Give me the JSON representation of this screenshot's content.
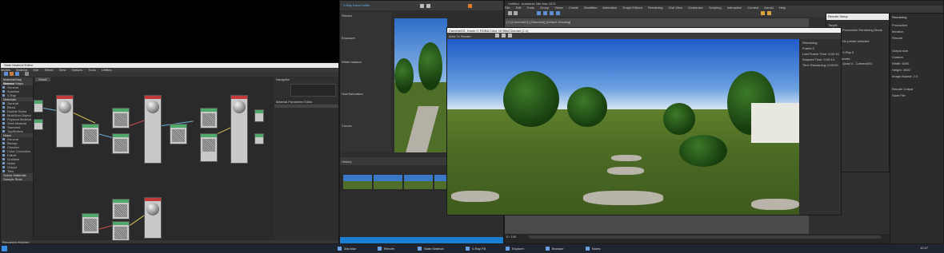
{
  "slate": {
    "title": "Slate Material Editor",
    "menu": [
      "Modes",
      "Material",
      "Edit",
      "Select",
      "View",
      "Options",
      "Tools",
      "Utilities"
    ],
    "view_tab": "View1",
    "browser_head": "Material/Map Browser",
    "browser_items": [
      "Material Maps",
      "General",
      "Scanline",
      "V-Ray",
      "Materials",
      "General",
      "Blend",
      "Double Sided",
      "Multi/Sub-Object",
      "Physical Material",
      "Shell Material",
      "Standard",
      "Top/Bottom",
      "Maps",
      "General",
      "Bitmap",
      "Checker",
      "Color Correction",
      "Falloff",
      "Gradient",
      "Noise",
      "Output",
      "Tiles",
      "Scene Materials",
      "Sample Slots"
    ],
    "navigator": "Navigator",
    "param_editor": "Material Parameter Editor",
    "status": "Rendering finished"
  },
  "vfb": {
    "title": "V-Ray frame buffer",
    "tab": "Stream",
    "label_a": "Exposure",
    "label_b": "White balance",
    "label_c": "Hue/Saturation",
    "label_d": "Curves",
    "history": "History"
  },
  "max": {
    "title": "Untitled - Autodesk 3ds Max 2021",
    "menu": [
      "File",
      "Edit",
      "Tools",
      "Group",
      "Views",
      "Create",
      "Modifiers",
      "Animation",
      "Graph Editors",
      "Rendering",
      "Civil View",
      "Customize",
      "Scripting",
      "Interactive",
      "Content",
      "Arnold",
      "Help"
    ],
    "viewport_label": "[+] [Camera001] [Standard] [Default Shading]",
    "frame_label": "0 / 100"
  },
  "render": {
    "title": "Camera001, frame 0, RGBA Color 16 Bits/Channel (1:1)",
    "viewport_tab": "Area To Render",
    "side_panel_title": "Render Setup",
    "side_rows": [
      "Target:",
      "Production Rendering Mode",
      "Preset:",
      "No preset selected",
      "Renderer:",
      "V-Ray 5",
      "View to Render:",
      "Quad 4 - Camera001"
    ],
    "stats": [
      "Rendering",
      "Frame 0",
      "Last Frame Time: 0:00:14",
      "Elapsed Time: 0:00:14",
      "Time Remaining: 0:00:00"
    ]
  },
  "right_panel": {
    "title": "Rendering",
    "rows": [
      "Production",
      "Iterative",
      "Render",
      "Output size",
      "Custom",
      "Width: 6000",
      "Height: 3000",
      "Image Aspect: 2.0",
      "Render Output",
      "Save File"
    ]
  },
  "taskbar": {
    "buttons": [
      "3ds Max",
      "Render",
      "Slate Material",
      "V-Ray FB",
      "Explorer",
      "Browser",
      "Notes"
    ],
    "time": "12:47"
  }
}
